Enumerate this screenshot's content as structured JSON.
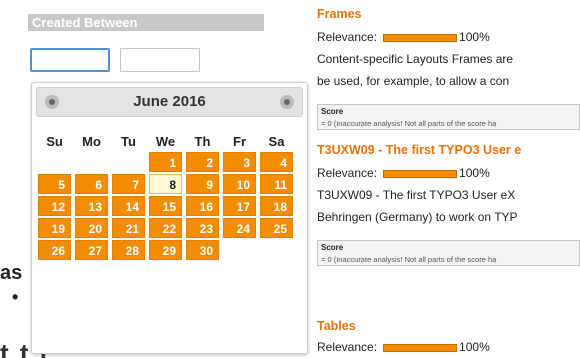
{
  "filter": {
    "header": "Created Between",
    "from_value": "",
    "to_value": ""
  },
  "background": {
    "fragment_as": "as",
    "fragment_dot": "•",
    "fragment_bottom": "t    t    l"
  },
  "datepicker": {
    "title": "June 2016",
    "weekdays": [
      "Su",
      "Mo",
      "Tu",
      "We",
      "Th",
      "Fr",
      "Sa"
    ],
    "weeks": [
      [
        "",
        "",
        "",
        "1",
        "2",
        "3",
        "4"
      ],
      [
        "5",
        "6",
        "7",
        "8",
        "9",
        "10",
        "11"
      ],
      [
        "12",
        "13",
        "14",
        "15",
        "16",
        "17",
        "18"
      ],
      [
        "19",
        "20",
        "21",
        "22",
        "23",
        "24",
        "25"
      ],
      [
        "26",
        "27",
        "28",
        "29",
        "30",
        "",
        ""
      ]
    ],
    "today": "8",
    "accent_color": "#f28c00"
  },
  "results": [
    {
      "title": "Frames",
      "relevance_label": "Relevance:",
      "relevance_value": "100%",
      "relevance_fraction": 1.0,
      "snippet_1": "Content-specific Layouts Frames are",
      "snippet_2": "be used, for example, to allow a con",
      "score_label": "Score",
      "score_text": "= 0 (Inaccurate analysis! Not all parts of the score ha"
    },
    {
      "title": "T3UXW09 - The first TYPO3 User e",
      "relevance_label": "Relevance:",
      "relevance_value": "100%",
      "relevance_fraction": 1.0,
      "snippet_1": "T3UXW09 - The first TYPO3 User eX",
      "snippet_2": "Behringen (Germany) to work on TYP",
      "score_label": "Score",
      "score_text": "= 0 (Inaccurate analysis! Not all parts of the score ha"
    },
    {
      "title": "Tables",
      "relevance_label": "Relevance:",
      "relevance_value": "100%",
      "relevance_fraction": 1.0
    }
  ]
}
